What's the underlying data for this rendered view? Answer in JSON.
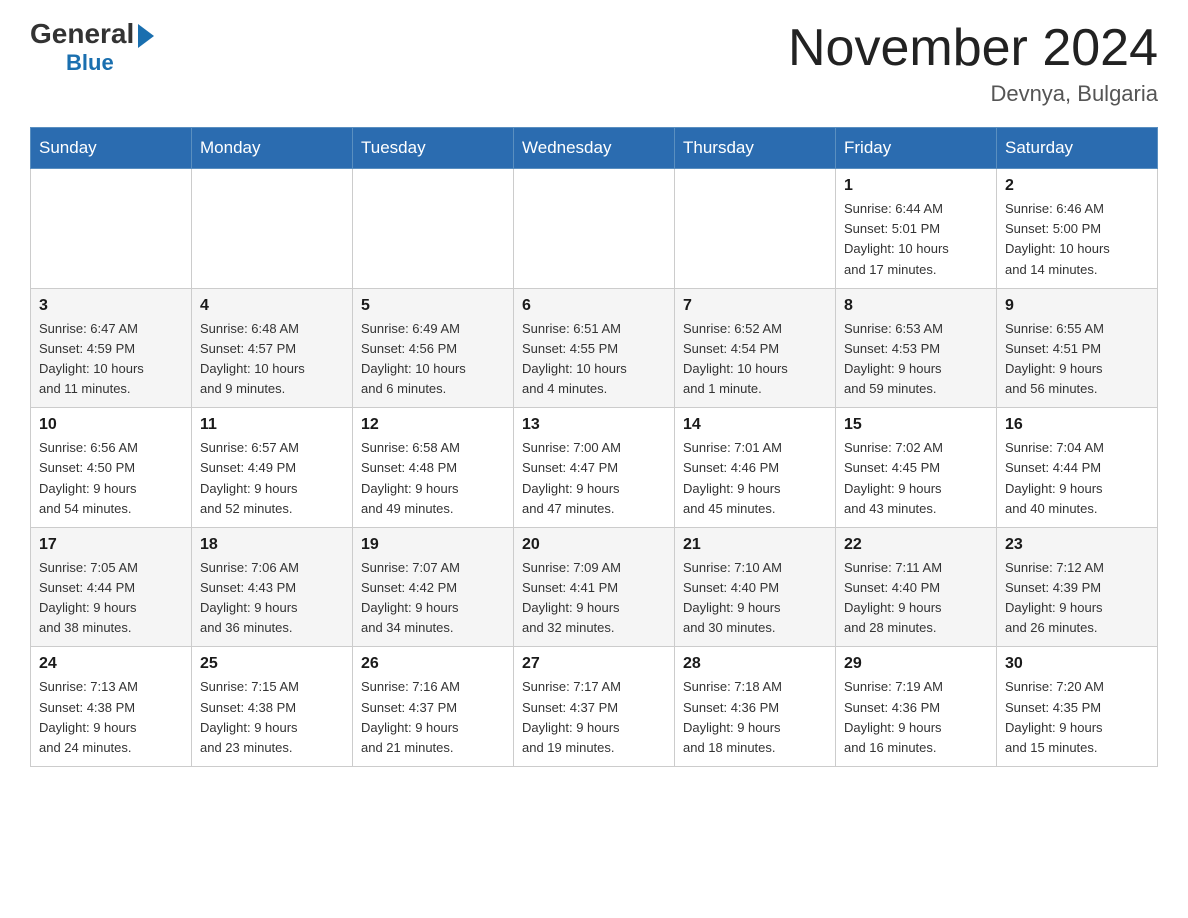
{
  "header": {
    "logo_general": "General",
    "logo_blue": "Blue",
    "month_title": "November 2024",
    "location": "Devnya, Bulgaria"
  },
  "weekdays": [
    "Sunday",
    "Monday",
    "Tuesday",
    "Wednesday",
    "Thursday",
    "Friday",
    "Saturday"
  ],
  "weeks": [
    [
      {
        "day": "",
        "info": ""
      },
      {
        "day": "",
        "info": ""
      },
      {
        "day": "",
        "info": ""
      },
      {
        "day": "",
        "info": ""
      },
      {
        "day": "",
        "info": ""
      },
      {
        "day": "1",
        "info": "Sunrise: 6:44 AM\nSunset: 5:01 PM\nDaylight: 10 hours\nand 17 minutes."
      },
      {
        "day": "2",
        "info": "Sunrise: 6:46 AM\nSunset: 5:00 PM\nDaylight: 10 hours\nand 14 minutes."
      }
    ],
    [
      {
        "day": "3",
        "info": "Sunrise: 6:47 AM\nSunset: 4:59 PM\nDaylight: 10 hours\nand 11 minutes."
      },
      {
        "day": "4",
        "info": "Sunrise: 6:48 AM\nSunset: 4:57 PM\nDaylight: 10 hours\nand 9 minutes."
      },
      {
        "day": "5",
        "info": "Sunrise: 6:49 AM\nSunset: 4:56 PM\nDaylight: 10 hours\nand 6 minutes."
      },
      {
        "day": "6",
        "info": "Sunrise: 6:51 AM\nSunset: 4:55 PM\nDaylight: 10 hours\nand 4 minutes."
      },
      {
        "day": "7",
        "info": "Sunrise: 6:52 AM\nSunset: 4:54 PM\nDaylight: 10 hours\nand 1 minute."
      },
      {
        "day": "8",
        "info": "Sunrise: 6:53 AM\nSunset: 4:53 PM\nDaylight: 9 hours\nand 59 minutes."
      },
      {
        "day": "9",
        "info": "Sunrise: 6:55 AM\nSunset: 4:51 PM\nDaylight: 9 hours\nand 56 minutes."
      }
    ],
    [
      {
        "day": "10",
        "info": "Sunrise: 6:56 AM\nSunset: 4:50 PM\nDaylight: 9 hours\nand 54 minutes."
      },
      {
        "day": "11",
        "info": "Sunrise: 6:57 AM\nSunset: 4:49 PM\nDaylight: 9 hours\nand 52 minutes."
      },
      {
        "day": "12",
        "info": "Sunrise: 6:58 AM\nSunset: 4:48 PM\nDaylight: 9 hours\nand 49 minutes."
      },
      {
        "day": "13",
        "info": "Sunrise: 7:00 AM\nSunset: 4:47 PM\nDaylight: 9 hours\nand 47 minutes."
      },
      {
        "day": "14",
        "info": "Sunrise: 7:01 AM\nSunset: 4:46 PM\nDaylight: 9 hours\nand 45 minutes."
      },
      {
        "day": "15",
        "info": "Sunrise: 7:02 AM\nSunset: 4:45 PM\nDaylight: 9 hours\nand 43 minutes."
      },
      {
        "day": "16",
        "info": "Sunrise: 7:04 AM\nSunset: 4:44 PM\nDaylight: 9 hours\nand 40 minutes."
      }
    ],
    [
      {
        "day": "17",
        "info": "Sunrise: 7:05 AM\nSunset: 4:44 PM\nDaylight: 9 hours\nand 38 minutes."
      },
      {
        "day": "18",
        "info": "Sunrise: 7:06 AM\nSunset: 4:43 PM\nDaylight: 9 hours\nand 36 minutes."
      },
      {
        "day": "19",
        "info": "Sunrise: 7:07 AM\nSunset: 4:42 PM\nDaylight: 9 hours\nand 34 minutes."
      },
      {
        "day": "20",
        "info": "Sunrise: 7:09 AM\nSunset: 4:41 PM\nDaylight: 9 hours\nand 32 minutes."
      },
      {
        "day": "21",
        "info": "Sunrise: 7:10 AM\nSunset: 4:40 PM\nDaylight: 9 hours\nand 30 minutes."
      },
      {
        "day": "22",
        "info": "Sunrise: 7:11 AM\nSunset: 4:40 PM\nDaylight: 9 hours\nand 28 minutes."
      },
      {
        "day": "23",
        "info": "Sunrise: 7:12 AM\nSunset: 4:39 PM\nDaylight: 9 hours\nand 26 minutes."
      }
    ],
    [
      {
        "day": "24",
        "info": "Sunrise: 7:13 AM\nSunset: 4:38 PM\nDaylight: 9 hours\nand 24 minutes."
      },
      {
        "day": "25",
        "info": "Sunrise: 7:15 AM\nSunset: 4:38 PM\nDaylight: 9 hours\nand 23 minutes."
      },
      {
        "day": "26",
        "info": "Sunrise: 7:16 AM\nSunset: 4:37 PM\nDaylight: 9 hours\nand 21 minutes."
      },
      {
        "day": "27",
        "info": "Sunrise: 7:17 AM\nSunset: 4:37 PM\nDaylight: 9 hours\nand 19 minutes."
      },
      {
        "day": "28",
        "info": "Sunrise: 7:18 AM\nSunset: 4:36 PM\nDaylight: 9 hours\nand 18 minutes."
      },
      {
        "day": "29",
        "info": "Sunrise: 7:19 AM\nSunset: 4:36 PM\nDaylight: 9 hours\nand 16 minutes."
      },
      {
        "day": "30",
        "info": "Sunrise: 7:20 AM\nSunset: 4:35 PM\nDaylight: 9 hours\nand 15 minutes."
      }
    ]
  ]
}
